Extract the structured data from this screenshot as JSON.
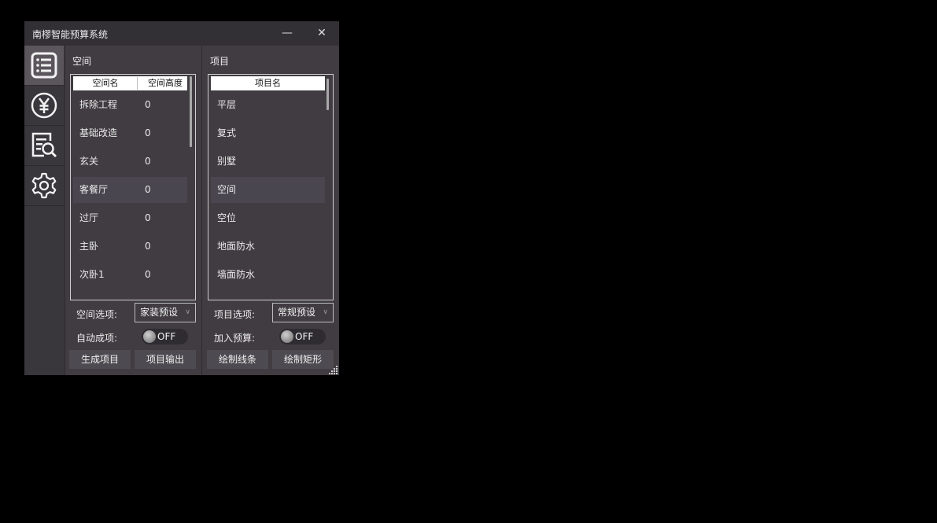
{
  "window": {
    "title": "南樛智能预算系统",
    "minimize_glyph": "—",
    "close_glyph": "✕"
  },
  "sidebar": {
    "items": [
      {
        "icon": "list-icon",
        "active": true
      },
      {
        "icon": "yen-icon",
        "active": false
      },
      {
        "icon": "document-search-icon",
        "active": false
      },
      {
        "icon": "gear-icon",
        "active": false
      }
    ]
  },
  "space_panel": {
    "title": "空间",
    "columns": [
      "空间名",
      "空间高度"
    ],
    "rows": [
      {
        "name": "拆除工程",
        "height": "0"
      },
      {
        "name": "基础改造",
        "height": "0"
      },
      {
        "name": "玄关",
        "height": "0"
      },
      {
        "name": "客餐厅",
        "height": "0"
      },
      {
        "name": "过厅",
        "height": "0"
      },
      {
        "name": "主卧",
        "height": "0"
      },
      {
        "name": "次卧1",
        "height": "0"
      }
    ],
    "selected_row": 3,
    "option_label": "空间选项:",
    "option_value": "家装预设",
    "auto_label": "自动成项:",
    "auto_toggle": "OFF",
    "btn_generate": "生成项目",
    "btn_export": "项目输出"
  },
  "project_panel": {
    "title": "项目",
    "columns": [
      "项目名"
    ],
    "rows": [
      "平层",
      "复式",
      "别墅",
      "空间",
      "空位",
      "地面防水",
      "墙面防水"
    ],
    "selected_row": 3,
    "option_label": "项目选项:",
    "option_value": "常规预设",
    "budget_label": "加入预算:",
    "budget_toggle": "OFF",
    "btn_draw_line": "绘制线条",
    "btn_draw_rect": "绘制矩形"
  },
  "colors": {
    "background": "#000000",
    "window": "#403c41",
    "titlebar": "#333035",
    "button": "#4e4a51"
  }
}
